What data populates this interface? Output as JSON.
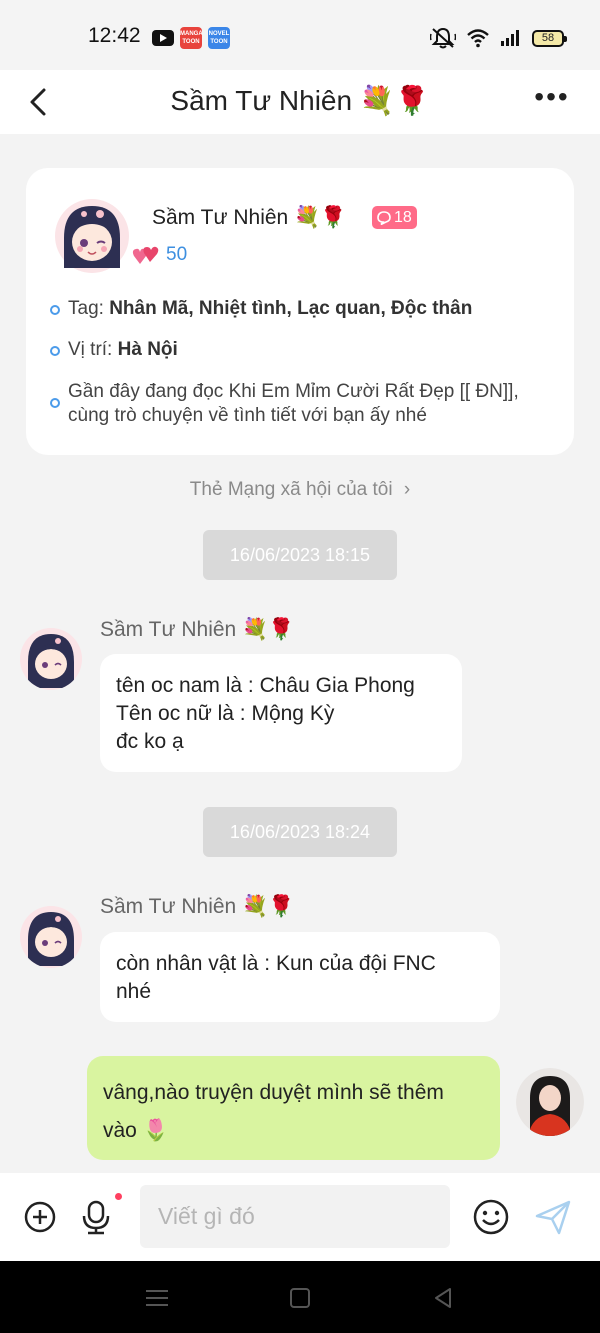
{
  "status_bar": {
    "time": "12:42",
    "app_manga": "MANGA TOON",
    "app_novel": "NOVEL TOON",
    "battery": "58"
  },
  "header": {
    "title": "Sầm Tư Nhiên",
    "title_emoji": "💐🌹"
  },
  "profile": {
    "name": "Sầm Tư Nhiên",
    "name_emoji": "💐🌹",
    "badge_count": "18",
    "score": "50",
    "tag_label": "Tag:",
    "tag_value": "Nhân Mã, Nhiệt tình, Lạc quan, Độc thân",
    "location_label": "Vị trí:",
    "location_value": "Hà Nội",
    "reading_line1": "Gần đây đang đọc Khi Em Mỉm Cười Rất Đẹp [[ ĐN]],",
    "reading_line2": "cùng trò chuyện về tình tiết với bạn ấy nhé"
  },
  "social_link": "Thẻ Mạng xã hội của tôi",
  "messages": [
    {
      "timestamp": "16/06/2023 18:15",
      "sender": "Sầm Tư Nhiên",
      "sender_emoji": "💐🌹",
      "lines": [
        "tên oc nam là : Châu Gia Phong",
        "Tên oc nữ là : Mộng Kỳ",
        "đc ko ạ"
      ]
    },
    {
      "timestamp": "16/06/2023 18:24",
      "sender": "Sầm Tư Nhiên",
      "sender_emoji": "💐🌹",
      "lines": [
        "còn nhân vật là : Kun của đội FNC",
        "nhé"
      ]
    }
  ],
  "my_message": {
    "line1": "vâng,nào truyện duyệt mình sẽ thêm",
    "line2": "vào 🌷"
  },
  "input": {
    "placeholder": "Viết gì đó"
  },
  "colors": {
    "accent_blue": "#3d8fe0",
    "badge_pink": "#ff6b88",
    "my_bubble": "#d9f4a0",
    "timestamp_bg": "#d9d9d9"
  }
}
